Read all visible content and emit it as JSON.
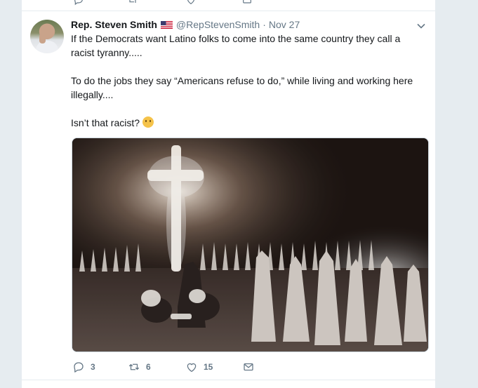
{
  "tweet": {
    "author_name": "Rep. Steven Smith",
    "handle": "@RepStevenSmith",
    "separator": "·",
    "date": "Nov 27",
    "paragraphs": [
      "If the Democrats want Latino folks to come into the same country they call a racist tyranny.....",
      "To do the jobs they say “Americans refuse to do,” while living and working here illegally....",
      "Isn’t that racist?"
    ],
    "emoji": "thinking-face-emoji"
  },
  "actions": {
    "reply_count": "3",
    "retweet_count": "6",
    "like_count": "15"
  },
  "colors": {
    "background": "#e6ecf0",
    "card": "#ffffff",
    "muted_text": "#657786",
    "body_text": "#14171a"
  },
  "icons": [
    "reply-icon",
    "retweet-icon",
    "like-icon",
    "direct-message-icon",
    "chevron-down-icon",
    "us-flag-icon"
  ]
}
